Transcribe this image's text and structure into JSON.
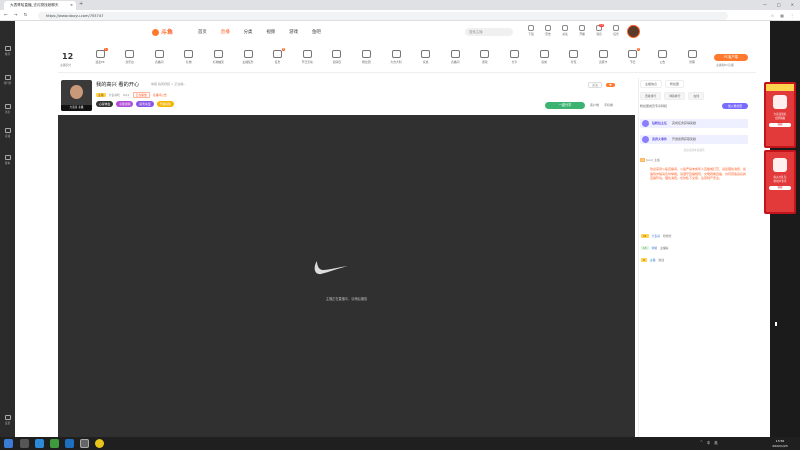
{
  "browser": {
    "tab_title": "大表哥哈直播_去礼物找她聊天",
    "url": "https://www.douyu.com/705747",
    "new_tab": "+"
  },
  "site": {
    "logo_text": "斗鱼",
    "nav": [
      "首页",
      "直播",
      "分类",
      "视频",
      "游戏",
      "鱼吧"
    ],
    "search_placeholder": "搜索主播",
    "header_icons": [
      {
        "label": "下载",
        "badge": ""
      },
      {
        "label": "历史",
        "badge": ""
      },
      {
        "label": "关注",
        "badge": ""
      },
      {
        "label": "开播",
        "badge": ""
      },
      {
        "label": "消息",
        "badge": "11"
      },
      {
        "label": "任务",
        "badge": ""
      },
      {
        "label": "地图",
        "badge": ""
      }
    ]
  },
  "sidebar": {
    "items": [
      "推荐",
      "排行榜",
      "消息",
      "直播",
      "赛事"
    ],
    "bottom": "设置"
  },
  "category": {
    "count": "12",
    "count_label": "主播积分",
    "items": [
      {
        "label": "连麦PK",
        "badge": "1"
      },
      {
        "label": "音乐台",
        "badge": ""
      },
      {
        "label": "直播间",
        "badge": ""
      },
      {
        "label": "礼物",
        "badge": ""
      },
      {
        "label": "礼物抽奖",
        "badge": ""
      },
      {
        "label": "主播任务",
        "badge": ""
      },
      {
        "label": "任务",
        "badge": "3"
      },
      {
        "label": "节日活动",
        "badge": ""
      },
      {
        "label": "表情包",
        "badge": ""
      },
      {
        "label": "粉丝团",
        "badge": ""
      },
      {
        "label": "大吉大利",
        "badge": ""
      },
      {
        "label": "家族",
        "badge": ""
      },
      {
        "label": "直播间",
        "badge": ""
      },
      {
        "label": "游戏",
        "badge": ""
      },
      {
        "label": "分享",
        "badge": ""
      },
      {
        "label": "商城",
        "badge": ""
      },
      {
        "label": "背包",
        "badge": ""
      },
      {
        "label": "贵宾卡",
        "badge": ""
      },
      {
        "label": "节日",
        "badge": "1"
      },
      {
        "label": "公告",
        "badge": ""
      },
      {
        "label": "管理",
        "badge": ""
      }
    ],
    "pc_button": "PC客户端",
    "pc_sub": "主播端PC直播"
  },
  "streamer": {
    "avatar_caption": "大表哥 主播",
    "title": "我的高兴 看的开心",
    "title_info": "举报  搞笑视频 > 正在播...",
    "tag1": "主播",
    "name": "大表哥哈",
    "level": "LV11",
    "tag_red": "正在播放",
    "extra": "直播间公告",
    "pill1": "心得体会",
    "pill2": "高能视频",
    "pill3": "搞笑动漫",
    "pill4": "开播提醒",
    "followers": "关注",
    "share_label": "一键分享",
    "actions": [
      "客户端",
      "手机看"
    ]
  },
  "player": {
    "loading_text": "主播正在直播中，请稍后播放"
  },
  "chat": {
    "tabs": [
      "主播信息",
      "粉丝团"
    ],
    "subtabs": [
      "贡献排行",
      "弹幕排行",
      "在线"
    ],
    "fan_text": "粉丝团成员专享特权",
    "fan_button": "加入粉丝团",
    "notice1_title": "钻粉拉主任",
    "notice1_text": "完成任务获得奖励",
    "notice2_title": "贵宾大事件",
    "notice2_text": "开通贵宾获取奖励",
    "sys": "欢迎来到本直播间",
    "chat1_level": "LV",
    "chat1_text": "[eco] 主播",
    "rules": "欢迎来到斗鱼直播间，斗鱼严禁未成年人直播或打赏，请您理性消费，如遇到诈骗请及时举报。请遵守直播规则，文明观看直播，共同营造良好的直播环境。理性消费，切勿私下交易，注意财产安全。",
    "lines": [
      {
        "level": "21",
        "user": "大表哥",
        "text": "哈哈哈"
      },
      {
        "level": "13",
        "user": "弹幕",
        "text": "主播好"
      },
      {
        "level": "8",
        "user": "主播",
        "text": "欢迎"
      }
    ]
  },
  "ads": [
    {
      "title": "大表哥豪礼",
      "sub": "立即领取",
      "btn": "领取"
    },
    {
      "title": "鱼丸大礼包",
      "sub": "新用户专享",
      "btn": "领取"
    }
  ],
  "taskbar": {
    "time": "13:56",
    "date": "2022/1/23",
    "tray": [
      "^",
      "中",
      "英"
    ]
  },
  "colors": {
    "accent": "#ff5d23",
    "player_bg": "#303030",
    "share_green": "#3cb371",
    "purple": "#7a6bff"
  }
}
